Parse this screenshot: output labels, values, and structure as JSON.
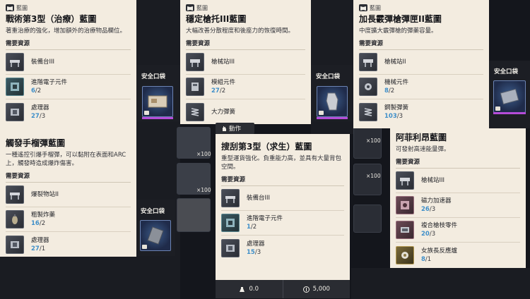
{
  "colors": {
    "accent_blue": "#3f8fc9",
    "panel_bg": "#f3ece0",
    "dark_bg": "#14161c",
    "rarity_purple": "#b44cd8"
  },
  "panels": [
    {
      "badge": "藍圖",
      "title": "戰術第3型（治療）藍圖",
      "desc": "著重治療的強化，增加額外的治療物品欄位。",
      "req_label": "需要資源",
      "resources": [
        {
          "name": "裝備台III",
          "have": "",
          "need": "",
          "icon": "workbench-icon"
        },
        {
          "name": "進階電子元件",
          "have": "6",
          "need": "/2",
          "icon": "circuit-icon"
        },
        {
          "name": "處理器",
          "have": "27",
          "need": "/3",
          "icon": "chip-icon"
        }
      ]
    },
    {
      "badge": "藍圖",
      "title": "穩定槍托III藍圖",
      "desc": "大幅改善分散程度和後座力的恢復時間。",
      "req_label": "需要資源",
      "resources": [
        {
          "name": "槍械站III",
          "have": "",
          "need": "",
          "icon": "gunbench-icon"
        },
        {
          "name": "模組元件",
          "have": "27",
          "need": "/2",
          "icon": "module-icon"
        },
        {
          "name": "大力彈簧",
          "have": "",
          "need": "",
          "icon": "spring-icon"
        }
      ]
    },
    {
      "badge": "藍圖",
      "title": "加長霰彈槍彈匣II藍圖",
      "desc": "中度擴大霰彈槍的彈藥容量。",
      "req_label": "需要資源",
      "resources": [
        {
          "name": "槍械站II",
          "have": "",
          "need": "",
          "icon": "gunbench-icon"
        },
        {
          "name": "機械元件",
          "have": "8",
          "need": "/2",
          "icon": "gear-icon"
        },
        {
          "name": "鋼製彈簧",
          "have": "103",
          "need": "/3",
          "icon": "spring-icon"
        }
      ]
    },
    {
      "badge": "",
      "title": "觸發手榴彈藍圖",
      "desc": "一種遙控引爆手榴彈，可以黏附在表面和ARC上，觸發時造成爆炸傷害。",
      "req_label": "需要資源",
      "resources": [
        {
          "name": "爆裂物站II",
          "have": "",
          "need": "",
          "icon": "explosives-bench-icon"
        },
        {
          "name": "粗製炸藥",
          "have": "16",
          "need": "/2",
          "icon": "explosive-icon"
        },
        {
          "name": "處理器",
          "have": "27",
          "need": "/1",
          "icon": "chip-icon"
        }
      ]
    },
    {
      "badge": "",
      "title": "搜刮第3型（求生）藍圖",
      "desc": "重型運貨強化。負重能力高，並具有大量背包空間。",
      "req_label": "需要資源",
      "resources": [
        {
          "name": "裝備台III",
          "have": "",
          "need": "",
          "icon": "workbench-icon"
        },
        {
          "name": "進階電子元件",
          "have": "1",
          "need": "/2",
          "icon": "circuit-icon"
        },
        {
          "name": "處理器",
          "have": "15",
          "need": "/3",
          "icon": "chip-icon"
        }
      ]
    },
    {
      "badge": "",
      "title": "阿菲利昂藍圖",
      "desc": "可發射高速能量彈。",
      "req_label": "需要資源",
      "resources": [
        {
          "name": "槍械站III",
          "have": "",
          "need": "",
          "icon": "gunbench-icon"
        },
        {
          "name": "磁力加速器",
          "have": "26",
          "need": "/3",
          "icon": "accelerator-icon"
        },
        {
          "name": "複合槍枝零件",
          "have": "20",
          "need": "/3",
          "icon": "gunparts-icon"
        },
        {
          "name": "女族長反應爐",
          "have": "8",
          "need": "/1",
          "icon": "reactor-icon"
        }
      ]
    }
  ],
  "safe_pocket_label": "安全口袋",
  "counts": [
    "×100",
    "×100",
    "×100",
    "×100"
  ],
  "action_label": "動作",
  "cost": {
    "weight": "0.0",
    "coins": "5,000"
  }
}
